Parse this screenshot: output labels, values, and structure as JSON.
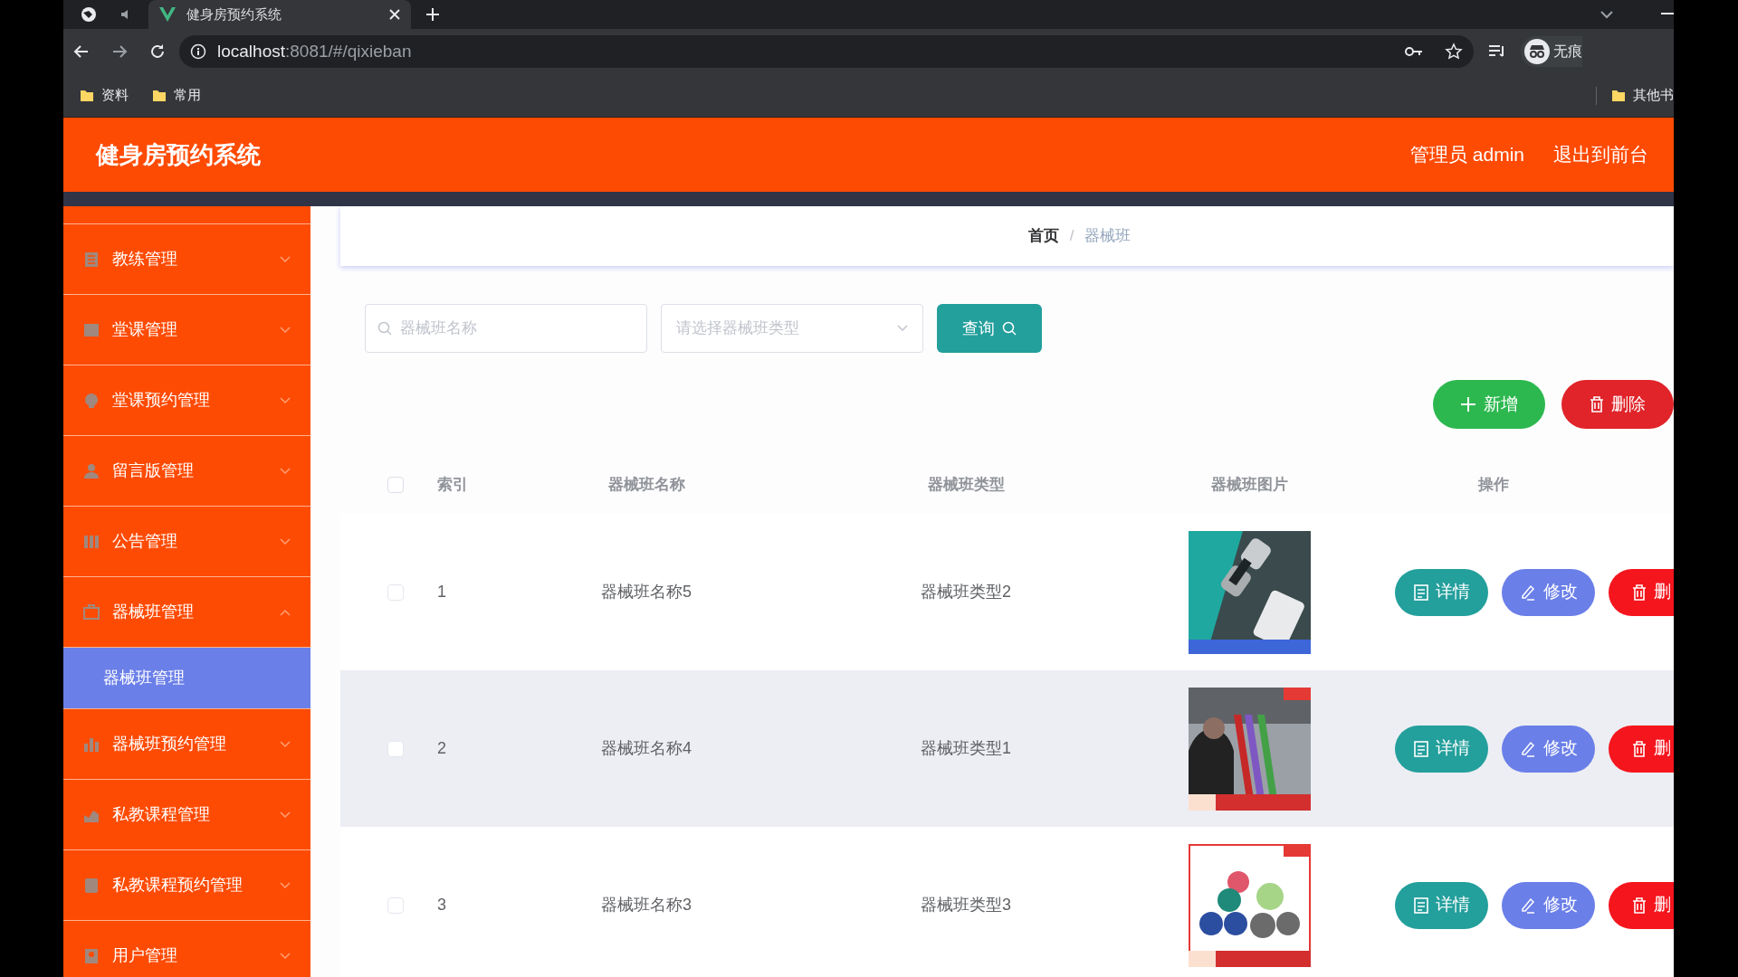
{
  "browser": {
    "tab_title": "健身房预约系统",
    "url_host": "localhost",
    "url_rest": ":8081/#/qixieban",
    "bookmarks": [
      "资料",
      "常用"
    ],
    "other_bookmarks": "其他书",
    "profile": "无痕"
  },
  "header": {
    "title": "健身房预约系统",
    "user": "管理员 admin",
    "exit": "退出到前台"
  },
  "sidebar": {
    "items": [
      {
        "label": "教练管理",
        "expanded": false
      },
      {
        "label": "堂课管理",
        "expanded": false
      },
      {
        "label": "堂课预约管理",
        "expanded": false
      },
      {
        "label": "留言版管理",
        "expanded": false
      },
      {
        "label": "公告管理",
        "expanded": false
      },
      {
        "label": "器械班管理",
        "expanded": true,
        "children": [
          {
            "label": "器械班管理",
            "selected": true
          }
        ]
      },
      {
        "label": "器械班预约管理",
        "expanded": false
      },
      {
        "label": "私教课程管理",
        "expanded": false
      },
      {
        "label": "私教课程预约管理",
        "expanded": false
      },
      {
        "label": "用户管理",
        "expanded": false
      }
    ]
  },
  "breadcrumb": [
    "首页",
    "器械班"
  ],
  "breadcrumb_separator": "/",
  "search": {
    "name_placeholder": "器械班名称",
    "type_placeholder": "请选择器械班类型",
    "button": "查询"
  },
  "toolbar": {
    "add": "新增",
    "delete": "删除"
  },
  "table": {
    "select_all_checked": false,
    "columns": [
      "索引",
      "器械班名称",
      "器械班类型",
      "器械班图片",
      "操作"
    ],
    "rows": [
      {
        "index": "1",
        "name": "器械班名称5",
        "type": "器械班类型2",
        "checked": false,
        "highlighted": false,
        "actions": [
          "详情",
          "修改",
          "删"
        ]
      },
      {
        "index": "2",
        "name": "器械班名称4",
        "type": "器械班类型1",
        "checked": false,
        "highlighted": true,
        "actions": [
          "详情",
          "修改",
          "删"
        ]
      },
      {
        "index": "3",
        "name": "器械班名称3",
        "type": "器械班类型3",
        "checked": false,
        "highlighted": false,
        "actions": [
          "详情",
          "修改",
          "删"
        ]
      }
    ]
  }
}
